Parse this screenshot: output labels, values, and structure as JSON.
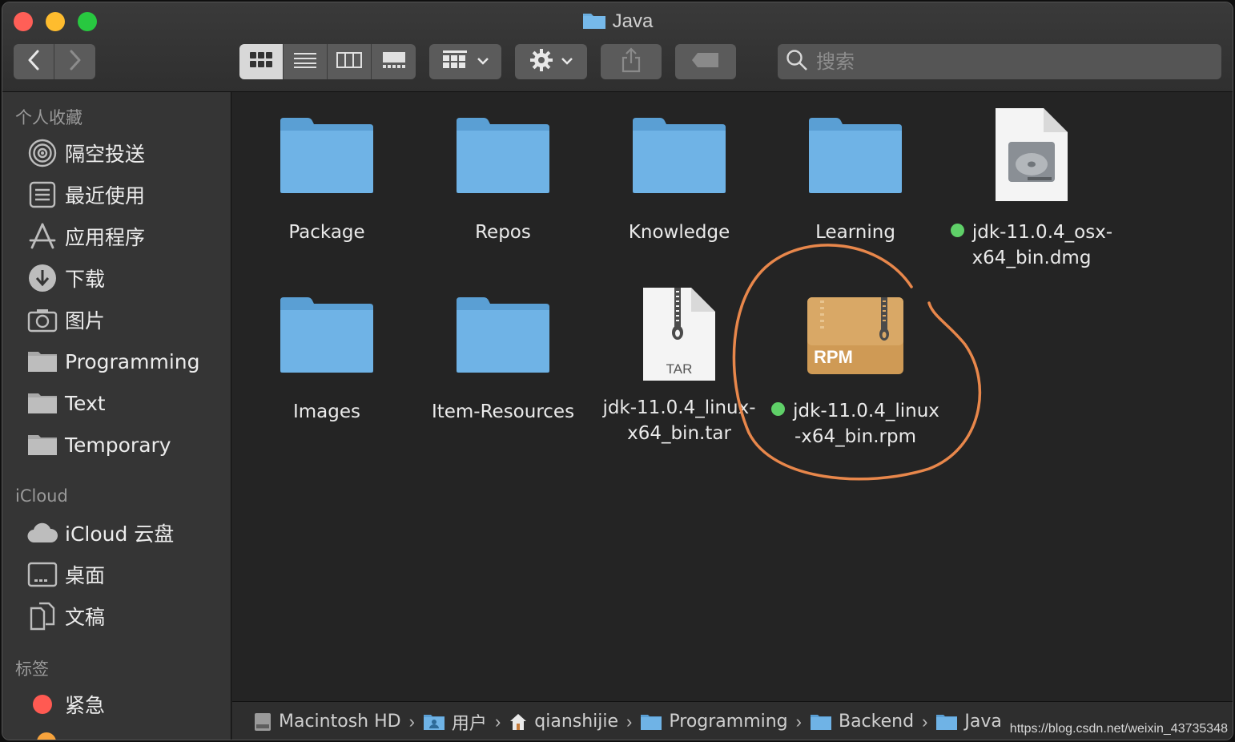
{
  "window": {
    "title": "Java"
  },
  "toolbar": {
    "back_icon": "chevron-left-icon",
    "forward_icon": "chevron-right-icon",
    "view_modes": [
      "icon-view",
      "list-view",
      "column-view",
      "gallery-view"
    ],
    "group_icon": "group-by-icon",
    "action_icon": "gear-icon",
    "share_icon": "share-icon",
    "tag_icon": "tag-icon",
    "search_placeholder": "搜索"
  },
  "sidebar": {
    "favorites_header": "个人收藏",
    "favorites": [
      {
        "label": "隔空投送",
        "icon": "airdrop-icon"
      },
      {
        "label": "最近使用",
        "icon": "recents-icon"
      },
      {
        "label": "应用程序",
        "icon": "applications-icon"
      },
      {
        "label": "下载",
        "icon": "downloads-icon"
      },
      {
        "label": "图片",
        "icon": "pictures-icon"
      },
      {
        "label": "Programming",
        "icon": "folder-icon"
      },
      {
        "label": "Text",
        "icon": "folder-icon"
      },
      {
        "label": "Temporary",
        "icon": "folder-icon"
      }
    ],
    "icloud_header": "iCloud",
    "icloud": [
      {
        "label": "iCloud 云盘",
        "icon": "cloud-icon"
      },
      {
        "label": "桌面",
        "icon": "desktop-icon"
      },
      {
        "label": "文稿",
        "icon": "documents-icon"
      }
    ],
    "tags_header": "标签",
    "tags": [
      {
        "label": "紧急",
        "color": "#ff5a52"
      }
    ]
  },
  "files": {
    "row1": [
      {
        "name": "Package",
        "kind": "folder"
      },
      {
        "name": "Repos",
        "kind": "folder"
      },
      {
        "name": "Knowledge",
        "kind": "folder"
      },
      {
        "name": "Learning",
        "kind": "folder"
      },
      {
        "name_line1": "jdk-11.0.4_osx-",
        "name_line2": "x64_bin.dmg",
        "kind": "dmg",
        "tag_color": "#5fd068"
      }
    ],
    "row2": [
      {
        "name": "Images",
        "kind": "folder"
      },
      {
        "name": "Item-Resources",
        "kind": "folder"
      },
      {
        "name_line1": "jdk-11.0.4_linux-",
        "name_line2": "x64_bin.tar",
        "kind": "tar",
        "badge": "TAR"
      },
      {
        "name_line1": "jdk-11.0.4_linux",
        "name_line2": "-x64_bin.rpm",
        "kind": "rpm",
        "badge": "RPM",
        "tag_color": "#5fd068"
      }
    ]
  },
  "pathbar": {
    "crumbs": [
      {
        "label": "Macintosh HD",
        "icon": "hard-drive-icon"
      },
      {
        "label": "用户",
        "icon": "users-folder-icon"
      },
      {
        "label": "qianshijie",
        "icon": "home-icon"
      },
      {
        "label": "Programming",
        "icon": "folder-icon"
      },
      {
        "label": "Backend",
        "icon": "folder-icon"
      },
      {
        "label": "Java",
        "icon": "folder-icon"
      }
    ],
    "separator": "›"
  },
  "watermark": "https://blog.csdn.net/weixin_43735348",
  "colors": {
    "folder_blue": "#6aaee0",
    "annotation_orange": "#e8874b",
    "tag_green": "#5fd068",
    "tag_red": "#ff5a52"
  }
}
